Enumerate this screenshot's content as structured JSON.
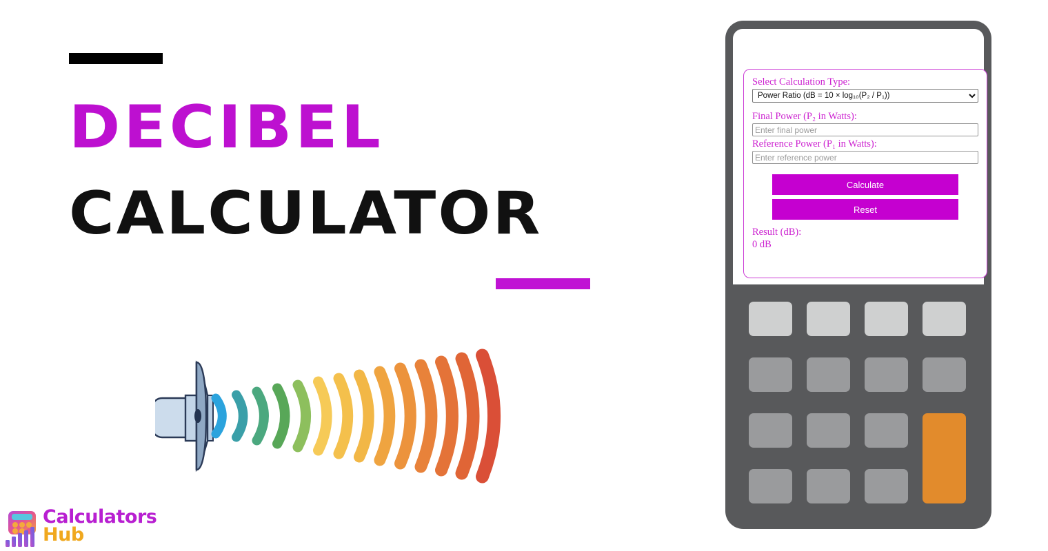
{
  "promo": {
    "headline_line1": "DECIBEL",
    "headline_line2": "CALCULATOR",
    "accent_color": "#bd10d0",
    "rule_color_top": "#000000",
    "rule_color_bottom": "#c012d4",
    "illustration": "speaker-sound-waves"
  },
  "logo": {
    "line1": "Calculators",
    "line2": "Hub",
    "line1_color": "#b81fd1",
    "line2_color": "#f0a81e",
    "mark": "calculator-bar-chart-icon"
  },
  "calculator": {
    "type_label": "Select Calculation Type:",
    "type_selected": "Power Ratio (dB = 10 × log₁₀(P₂ / P₁))",
    "type_options": [
      "Power Ratio (dB = 10 × log₁₀(P₂ / P₁))"
    ],
    "final_power_label": "Final Power (P₂ in Watts):",
    "final_power_value": "",
    "final_power_placeholder": "Enter final power",
    "reference_power_label": "Reference Power (P₁ in Watts):",
    "reference_power_value": "",
    "reference_power_placeholder": "Enter reference power",
    "calculate_label": "Calculate",
    "reset_label": "Reset",
    "result_label": "Result (dB):",
    "result_value": "0 dB",
    "button_color": "#c500d0",
    "border_color": "#cc3fd6",
    "label_color": "#cc22d0"
  },
  "device": {
    "body_color": "#58595b",
    "key_color": "#9a9b9d",
    "key_light_color": "#cfd0d0",
    "key_accent_color": "#e28b2c",
    "keys_rows": 4,
    "keys_cols": 4
  },
  "wave_colors": [
    "#2ba3dd",
    "#3a9fa8",
    "#4ba87f",
    "#58a758",
    "#8dbf5d",
    "#f6ca57",
    "#f4c04c",
    "#f2b746",
    "#efa440",
    "#ec933c",
    "#e8823a",
    "#e47338",
    "#e06536",
    "#da4f37"
  ]
}
